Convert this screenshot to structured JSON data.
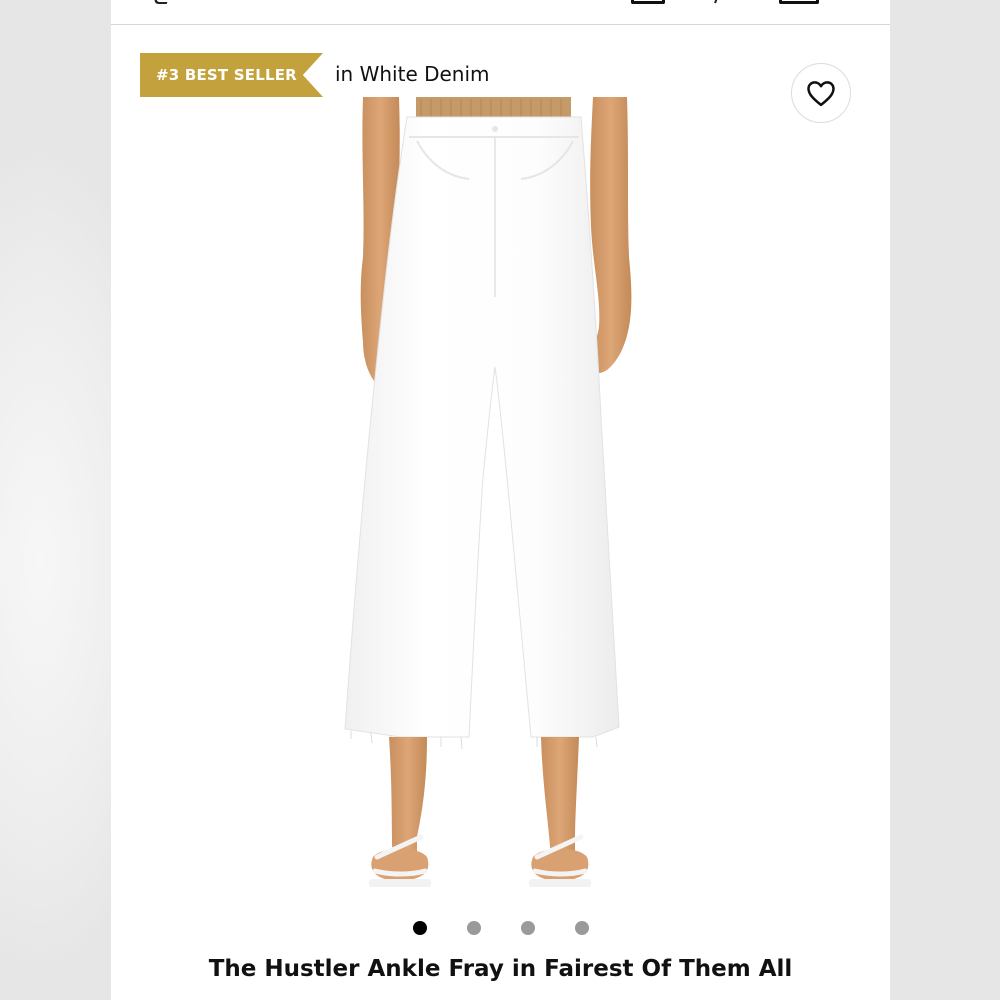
{
  "badge": {
    "label": "#3 BEST SELLER"
  },
  "product": {
    "color_label": "in White Denim",
    "title": "The Hustler Ankle Fray in Fairest Of Them All",
    "image_description_icon": "jeans-product-photo"
  },
  "header": {
    "icons": [
      "search-icon",
      "account-icon",
      "wishlist-icon",
      "bag-icon"
    ]
  },
  "carousel": {
    "total": 4,
    "active_index": 0
  },
  "colors": {
    "badge": "#c3a13d",
    "text": "#111111",
    "dot_active": "#000000",
    "dot_inactive": "#9a9a9a"
  }
}
